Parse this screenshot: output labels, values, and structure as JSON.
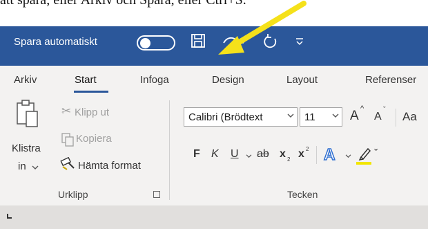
{
  "intro_text": "att spara, eller Arkiv och Spara, eller Ctrl+S.",
  "titlebar": {
    "autosave_label": "Spara automatiskt",
    "autosave_state": "off",
    "bg_color": "#2b579a"
  },
  "tabs": [
    "Arkiv",
    "Start",
    "Infoga",
    "Design",
    "Layout",
    "Referenser"
  ],
  "active_tab": "Start",
  "clipboard": {
    "paste_label_line1": "Klistra",
    "paste_label_line2": "in",
    "cut_label": "Klipp ut",
    "copy_label": "Kopiera",
    "format_painter_label": "Hämta format",
    "group_label": "Urklipp"
  },
  "font": {
    "font_name": "Calibri (Brödtext",
    "font_size": "11",
    "bold_label": "F",
    "italic_label": "K",
    "underline_label": "U",
    "strike_label": "ab",
    "subscript_label": "x",
    "superscript_label": "x",
    "text_effects_label": "A",
    "grow_label": "A",
    "shrink_label": "A",
    "case_label": "Aa",
    "group_label": "Tecken"
  },
  "colors": {
    "accent": "#2b579a",
    "arrow": "#f5e11a",
    "highlight": "#f2e600"
  }
}
